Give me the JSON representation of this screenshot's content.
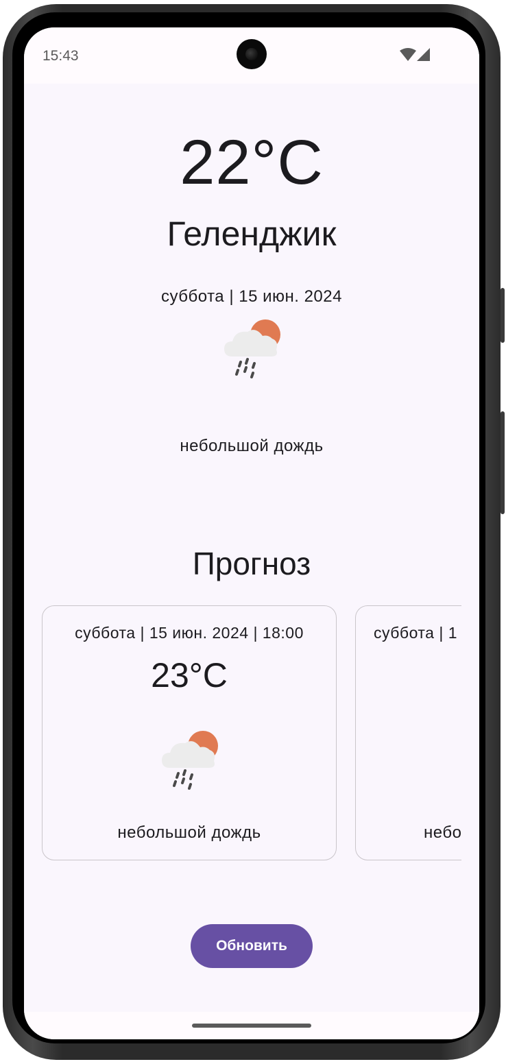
{
  "status_bar": {
    "time": "15:43",
    "icons": [
      "wifi-icon",
      "signal-icon"
    ]
  },
  "current": {
    "temperature": "22°C",
    "city": "Геленджик",
    "date": "суббота | 15 июн. 2024",
    "icon": "rain-cloud-sun-icon",
    "description": "небольшой дождь"
  },
  "forecast": {
    "heading": "Прогноз",
    "cards": [
      {
        "date": "суббота | 15 июн. 2024 | 18:00",
        "temperature": "23°C",
        "icon": "rain-cloud-sun-icon",
        "description": "небольшой дождь"
      },
      {
        "date": "суббота | 1",
        "description": "небо"
      }
    ]
  },
  "actions": {
    "refresh_label": "Обновить"
  },
  "colors": {
    "accent": "#6750a4",
    "background": "#faf6fd",
    "sun": "#e07a52",
    "cloud": "#ececec",
    "rain": "#4a4a4a"
  }
}
